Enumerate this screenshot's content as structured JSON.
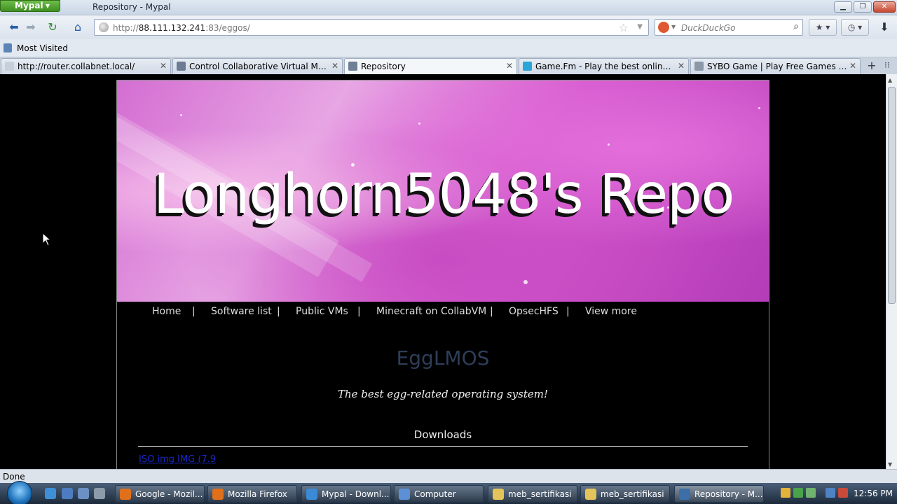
{
  "window": {
    "app_menu": "Mypal",
    "title": "Repository - Mypal",
    "min_icon": "minimize-icon",
    "max_icon": "restore-icon",
    "close_icon": "close-icon"
  },
  "nav": {
    "url_prefix": "http://",
    "url_host": "88.111.132.241",
    "url_path": ":83/eggos/",
    "search_placeholder": "DuckDuckGo"
  },
  "bookmarks": {
    "most_visited": "Most Visited"
  },
  "tabs": [
    {
      "label": "http://router.collabnet.local/",
      "active": false
    },
    {
      "label": "Control Collaborative Virtual Machin...",
      "active": false
    },
    {
      "label": "Repository",
      "active": true
    },
    {
      "label": "Game.Fm - Play the best online gam...",
      "active": false
    },
    {
      "label": "SYBO Game | Play Free Games for m...",
      "active": false
    }
  ],
  "page": {
    "banner_title": "Longhorn5048's Repo",
    "menu": [
      "Home",
      "Software list",
      "Public VMs",
      "Minecraft on CollabVM",
      "OpsecHFS",
      "View more"
    ],
    "menu_separator": "|",
    "heading": "EggLMOS",
    "tagline": "The best egg-related operating system!",
    "downloads_title": "Downloads",
    "download_link": "ISO img IMG (7.9"
  },
  "status": {
    "text": "Done"
  },
  "taskbar": {
    "tasks": [
      {
        "label": "Google - Mozil...",
        "color": "#e0701c"
      },
      {
        "label": "Mozilla Firefox",
        "color": "#e0701c"
      },
      {
        "label": "Mypal - Downl...",
        "color": "#3b8ad8"
      },
      {
        "label": "Computer",
        "color": "#5c8fd6"
      },
      {
        "label": "meb_sertifikasi",
        "color": "#e4c45a"
      },
      {
        "label": "meb_sertifikasi",
        "color": "#e4c45a"
      },
      {
        "label": "Repository - M...",
        "color": "#3c6ea8"
      }
    ],
    "clock": "12:56 PM"
  }
}
